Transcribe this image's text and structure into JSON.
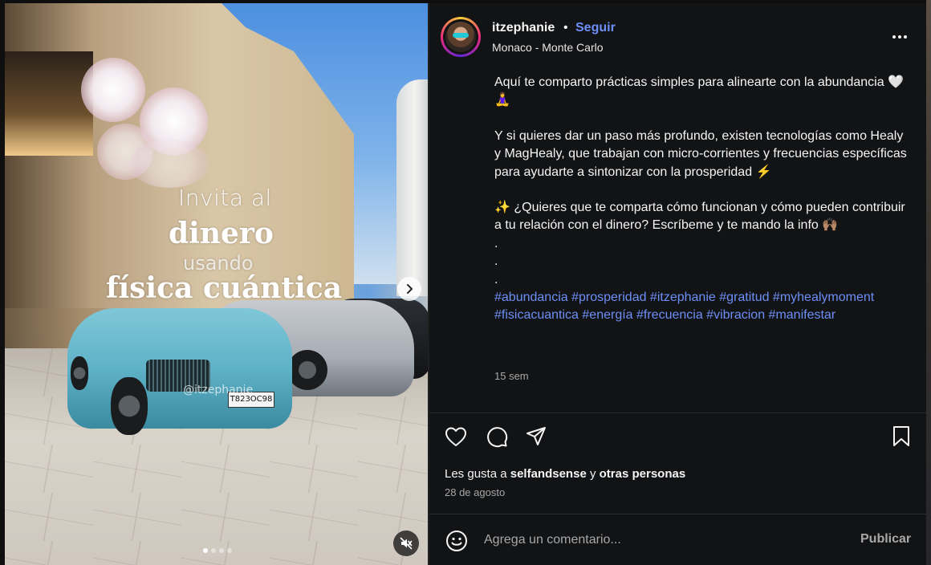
{
  "post": {
    "overlay": {
      "line1": "Invita al",
      "line2": "dinero",
      "line3": "usando",
      "line4": "física cuántica",
      "watermark": "@itzephanie",
      "plate": "T823OC98"
    },
    "carousel": {
      "count": 4,
      "active": 0
    }
  },
  "header": {
    "username": "itzephanie",
    "separator": "•",
    "follow_label": "Seguir",
    "location": "Monaco - Monte Carlo"
  },
  "caption": {
    "p1": "Aquí te comparto prácticas simples para alinearte con la abundancia 🤍 🧘‍♀️",
    "p2": "Y si quieres dar un paso más profundo, existen tecnologías como Healy y MagHealy, que trabajan con micro-corrientes y frecuencias específicas para ayudarte a sintonizar con la prosperidad ⚡",
    "p3": "✨ ¿Quieres que te comparta cómo funcionan y cómo pueden contribuir a tu relación con el dinero? Escríbeme y te mando la info 🙌🏽",
    "dot1": ".",
    "dot2": ".",
    "dot3": ".",
    "hashtags": "#abundancia #prosperidad #itzephanie #gratitud #myhealymoment #fisicacuantica #energía #frecuencia #vibracion #manifestar",
    "time_ago": "15 sem"
  },
  "likes": {
    "prefix": "Les gusta a ",
    "user": "selfandsense",
    "middle": " y ",
    "others": "otras personas"
  },
  "date": "28 de agosto",
  "comment": {
    "placeholder": "Agrega un comentario...",
    "publish_label": "Publicar"
  },
  "colors": {
    "panel_bg": "#121315",
    "link": "#6d8ff7",
    "muted": "#a8a8a8"
  },
  "icons": [
    "heart-icon",
    "comment-icon",
    "share-icon",
    "bookmark-icon",
    "more-icon",
    "emoji-icon",
    "mute-icon",
    "chevron-right-icon"
  ]
}
